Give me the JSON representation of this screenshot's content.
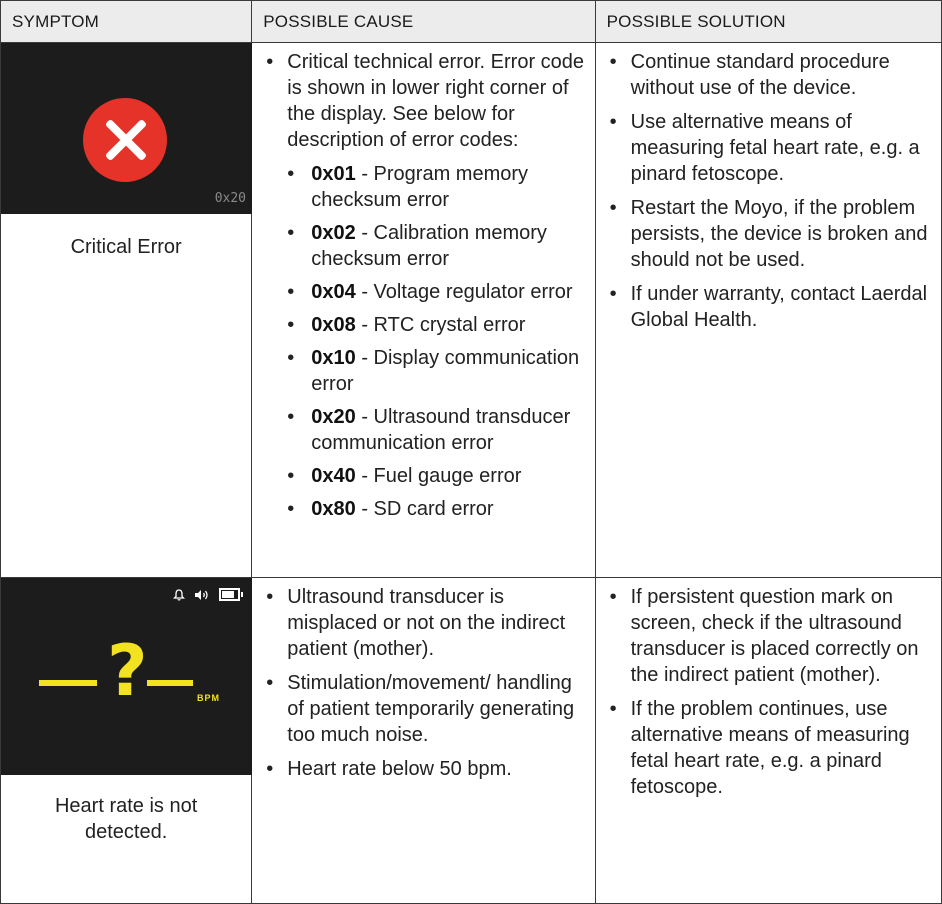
{
  "headers": {
    "symptom": "SYMPTOM",
    "cause": "POSSIBLE CAUSE",
    "solution": "POSSIBLE SOLUTION"
  },
  "row1": {
    "screen": {
      "error_code": "0x20",
      "icon": "x-circle-icon",
      "icon_color": "#e5332a"
    },
    "symptom": "Critical Error",
    "cause_intro": "Critical technical error. Error code is shown in lower right corner of the display. See below for description of error codes:",
    "codes": [
      {
        "code": "0x01",
        "desc": " - Program memory checksum error"
      },
      {
        "code": "0x02",
        "desc": " - Calibration memory checksum error"
      },
      {
        "code": "0x04",
        "desc": " - Voltage regulator error"
      },
      {
        "code": "0x08",
        "desc": " - RTC crystal error"
      },
      {
        "code": "0x10",
        "desc": " - Display communication error"
      },
      {
        "code": "0x20",
        "desc": " - Ultrasound transducer communication error"
      },
      {
        "code": "0x40",
        "desc": " - Fuel gauge error"
      },
      {
        "code": "0x80",
        "desc": " - SD card error"
      }
    ],
    "solutions": [
      "Continue standard procedure without use of the device.",
      "Use alternative means of measuring fetal heart rate, e.g. a pinard fetoscope.",
      "Restart the Moyo, if the problem persists, the device is broken and should not be used.",
      "If under warranty, contact Laerdal Global Health."
    ]
  },
  "row2": {
    "screen": {
      "symbol": "?",
      "unit": "BPM",
      "accent": "#f2e21f",
      "battery_level": 0.8,
      "status_icons": [
        "bell-icon",
        "speaker-icon",
        "battery-icon"
      ]
    },
    "symptom": "Heart rate is not detected.",
    "causes": [
      "Ultrasound transducer is misplaced or not on the indirect patient (mother).",
      "Stimulation/movement/ handling of patient temporarily generating too much noise.",
      "Heart rate below 50 bpm."
    ],
    "solutions": [
      "If persistent question mark on screen, check if the ultrasound transducer is placed correctly on the indirect patient (mother).",
      "If the problem continues, use alternative means of measuring fetal heart rate, e.g. a pinard fetoscope."
    ]
  }
}
